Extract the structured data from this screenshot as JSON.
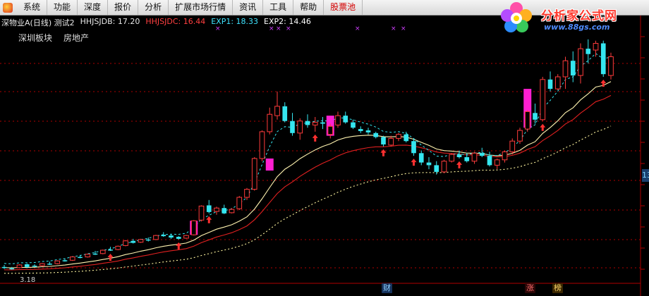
{
  "menu": {
    "items": [
      "系统",
      "功能",
      "深度",
      "报价",
      "分析",
      "扩展市场行情",
      "资讯",
      "工具",
      "帮助",
      "股票池"
    ],
    "highlighted": "股票池"
  },
  "logo": {
    "title": "分析家公式网",
    "url": "www.88gs.com"
  },
  "header": {
    "stock_name": "深物业A(日线) 测试2",
    "indicators": [
      {
        "label": "HHJSJDB: 17.20",
        "color": "#e8e8e8"
      },
      {
        "label": "HHJSJDC: 16.44",
        "color": "#ff4040"
      },
      {
        "label": "EXP1: 18.33",
        "color": "#3fe3ff"
      },
      {
        "label": "EXP2: 14.46",
        "color": "#ffffff"
      }
    ],
    "sector": "深圳板块",
    "industry": "房地产"
  },
  "axis": {
    "price_tag": "13",
    "low_label": "3.18"
  },
  "markers": {
    "cai": "财",
    "zhang": "涨",
    "bang": "榜"
  },
  "colors": {
    "up": "#ff3b3b",
    "down": "#35e6f0",
    "grid": "#b00000",
    "exp1": "#35e6f0",
    "exp2": "#ffffff",
    "magenta": "#ff1fd2"
  },
  "chart_data": {
    "type": "candlestick",
    "price_range": [
      2.5,
      20.5
    ],
    "candles": [
      [
        3.3,
        3.45,
        3.15,
        3.25
      ],
      [
        3.2,
        3.3,
        3.1,
        3.15
      ],
      [
        3.25,
        3.5,
        3.2,
        3.45
      ],
      [
        3.5,
        3.55,
        3.2,
        3.3
      ],
      [
        3.4,
        3.5,
        3.3,
        3.35
      ],
      [
        3.4,
        3.6,
        3.35,
        3.55
      ],
      [
        3.55,
        3.7,
        3.45,
        3.5
      ],
      [
        3.55,
        3.8,
        3.5,
        3.75
      ],
      [
        3.8,
        3.95,
        3.7,
        3.75
      ],
      [
        3.8,
        4.1,
        3.75,
        4.05
      ],
      [
        4.05,
        4.2,
        3.95,
        4.0
      ],
      [
        4.05,
        4.3,
        4.0,
        4.25
      ],
      [
        4.3,
        4.5,
        4.2,
        4.25
      ],
      [
        4.3,
        4.6,
        4.25,
        4.55
      ],
      [
        4.6,
        4.8,
        4.5,
        4.55
      ],
      [
        4.6,
        4.9,
        4.55,
        4.85
      ],
      [
        4.9,
        5.3,
        4.85,
        5.25
      ],
      [
        5.25,
        5.4,
        5.05,
        5.1
      ],
      [
        5.15,
        5.4,
        5.1,
        5.35
      ],
      [
        5.35,
        5.5,
        5.2,
        5.3
      ],
      [
        5.35,
        5.7,
        5.3,
        5.65
      ],
      [
        5.7,
        5.9,
        5.55,
        5.6
      ],
      [
        5.65,
        5.75,
        5.4,
        5.5
      ],
      [
        5.55,
        5.6,
        5.35,
        5.4
      ],
      [
        5.45,
        5.7,
        5.4,
        5.65
      ],
      [
        5.7,
        6.8,
        5.65,
        6.75
      ],
      [
        6.8,
        7.9,
        6.7,
        7.85
      ],
      [
        7.9,
        8.3,
        7.3,
        7.4
      ],
      [
        7.45,
        7.8,
        7.2,
        7.7
      ],
      [
        7.7,
        7.95,
        7.25,
        7.3
      ],
      [
        7.35,
        7.7,
        7.3,
        7.6
      ],
      [
        7.65,
        8.6,
        7.55,
        8.5
      ],
      [
        8.5,
        9.2,
        8.3,
        9.1
      ],
      [
        9.1,
        11.5,
        9.0,
        11.4
      ],
      [
        11.4,
        13.5,
        11.2,
        13.4
      ],
      [
        13.4,
        15.2,
        13.2,
        14.7
      ],
      [
        14.6,
        16.4,
        14.3,
        15.3
      ],
      [
        15.3,
        15.6,
        14.1,
        14.2
      ],
      [
        14.2,
        14.8,
        13.1,
        13.3
      ],
      [
        13.3,
        14.4,
        12.8,
        14.2
      ],
      [
        14.2,
        14.7,
        13.7,
        13.9
      ],
      [
        13.9,
        14.5,
        13.4,
        14.1
      ],
      [
        14.1,
        14.5,
        13.6,
        14.0
      ],
      [
        13.2,
        14.0,
        12.9,
        13.8
      ],
      [
        13.9,
        14.9,
        13.7,
        14.6
      ],
      [
        14.6,
        14.9,
        14.0,
        14.1
      ],
      [
        14.1,
        14.3,
        13.6,
        13.7
      ],
      [
        13.6,
        13.8,
        13.3,
        13.45
      ],
      [
        13.5,
        13.7,
        13.2,
        13.35
      ],
      [
        13.3,
        13.4,
        12.9,
        13.0
      ],
      [
        13.0,
        13.1,
        12.3,
        12.45
      ],
      [
        12.4,
        13.1,
        12.3,
        12.9
      ],
      [
        12.9,
        13.3,
        12.7,
        13.2
      ],
      [
        13.2,
        13.4,
        12.6,
        12.7
      ],
      [
        12.7,
        12.9,
        11.6,
        11.8
      ],
      [
        11.8,
        12.0,
        10.9,
        11.1
      ],
      [
        11.1,
        11.5,
        10.6,
        10.9
      ],
      [
        10.9,
        11.2,
        10.2,
        10.4
      ],
      [
        10.4,
        11.3,
        10.3,
        11.2
      ],
      [
        11.2,
        11.8,
        11.1,
        11.7
      ],
      [
        11.7,
        12.0,
        11.4,
        11.5
      ],
      [
        11.5,
        11.8,
        11.1,
        11.2
      ],
      [
        11.2,
        11.9,
        11.0,
        11.8
      ],
      [
        11.8,
        12.2,
        11.5,
        11.6
      ],
      [
        11.6,
        11.9,
        10.8,
        10.9
      ],
      [
        10.9,
        11.4,
        10.6,
        11.3
      ],
      [
        11.3,
        12.0,
        11.1,
        11.9
      ],
      [
        11.9,
        12.9,
        11.7,
        12.7
      ],
      [
        12.7,
        13.7,
        12.5,
        13.5
      ],
      [
        13.6,
        15.0,
        13.4,
        14.9
      ],
      [
        14.8,
        15.5,
        14.0,
        14.3
      ],
      [
        14.3,
        17.5,
        14.2,
        17.3
      ],
      [
        17.3,
        17.9,
        16.4,
        16.6
      ],
      [
        16.6,
        17.7,
        16.5,
        17.5
      ],
      [
        17.5,
        19.0,
        16.6,
        18.7
      ],
      [
        18.7,
        19.4,
        17.1,
        17.6
      ],
      [
        17.6,
        20.0,
        17.0,
        19.6
      ],
      [
        19.6,
        20.3,
        18.5,
        19.2
      ],
      [
        19.5,
        20.2,
        19.0,
        20.0
      ],
      [
        20.0,
        20.2,
        17.5,
        17.7
      ],
      [
        17.6,
        19.3,
        17.3,
        19.0
      ]
    ],
    "magenta_bars": [
      {
        "candle": 25,
        "low": 5.7,
        "high": 6.75
      },
      {
        "candle": 35,
        "low": 10.5,
        "high": 11.4
      },
      {
        "candle": 43,
        "low": 13.1,
        "high": 14.6
      },
      {
        "candle": 69,
        "low": 13.7,
        "high": 16.6
      }
    ],
    "up_arrows": [
      14,
      23,
      27,
      41,
      50,
      54,
      60,
      71,
      79
    ]
  }
}
